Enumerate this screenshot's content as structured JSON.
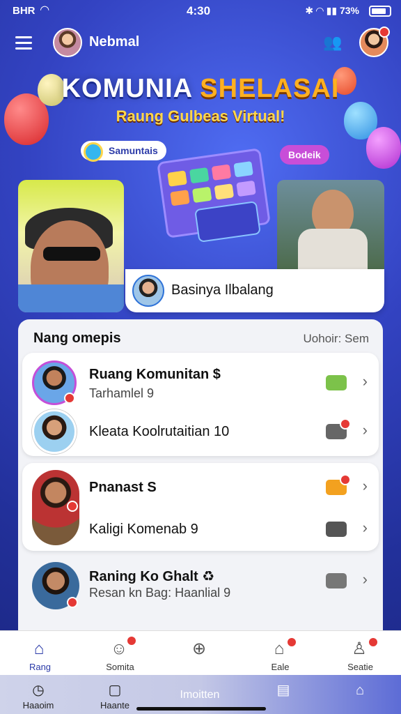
{
  "status": {
    "carrier": "BHR",
    "time": "4:30",
    "battery": "73%"
  },
  "header": {
    "username": "Nebmal"
  },
  "banner": {
    "title_word1": "KOMUNIA",
    "title_word2": "SHELASAI",
    "subtitle": "Raung Gulbeas Virtual!",
    "tag_left": "Samuntais",
    "tag_right": "Bodeik",
    "featured_name": "Basinya Ilbalang"
  },
  "section": {
    "title": "Nang omepis",
    "link": "Uohoir: Sem"
  },
  "items": [
    {
      "title": "Ruang Komunitan",
      "title_suffix": "$",
      "subtitle": "Tarhamlel 9",
      "icon_color": "#7cc24a"
    },
    {
      "title": "Kleata Koolrutaitian",
      "title_suffix": "10",
      "icon_color": "#666666"
    },
    {
      "title": "Pnanast",
      "title_suffix": "S",
      "icon_color": "#f3a11f"
    },
    {
      "title": "Kaligi Komenab",
      "title_suffix": "9",
      "icon_color": "#555555"
    },
    {
      "title": "Raning Ko Ghalt",
      "title_suffix": "♻",
      "subtitle": "Resan kn Bag: Haanlial 9",
      "icon_color": "#777777"
    }
  ],
  "tabs": [
    {
      "label": "Rang",
      "icon": "home-icon"
    },
    {
      "label": "Somita",
      "icon": "smile-icon"
    },
    {
      "label": "",
      "icon": "plus-circle-icon"
    },
    {
      "label": "Eale",
      "icon": "bell-icon"
    },
    {
      "label": "Seatie",
      "icon": "user-icon"
    }
  ],
  "system_nav": [
    {
      "label": "Haaoim",
      "icon": "clock-icon"
    },
    {
      "label": "Haante",
      "icon": "square-icon"
    },
    {
      "label": "Imoitten",
      "icon": ""
    },
    {
      "label": "",
      "icon": "panel-icon"
    },
    {
      "label": "",
      "icon": "user-outline-icon"
    }
  ]
}
